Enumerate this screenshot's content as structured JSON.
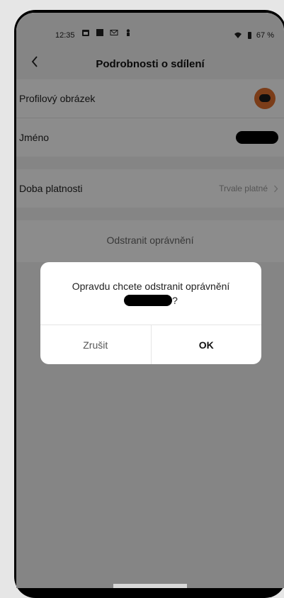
{
  "status_bar": {
    "time": "12:35",
    "battery": "67 %",
    "icons": [
      "calendar-icon",
      "square-icon",
      "mail-icon",
      "person-icon",
      "wifi-icon",
      "battery-icon"
    ]
  },
  "header": {
    "back_icon": "chevron-left-icon",
    "title": "Podrobnosti o sdílení"
  },
  "details": {
    "profile_picture_label": "Profilový obrázek",
    "name_label": "Jméno",
    "validity_label": "Doba platnosti",
    "validity_value": "Trvale platné",
    "remove_label": "Odstranit oprávnění"
  },
  "dialog": {
    "message": "Opravdu chcete odstranit oprávnění",
    "suffix": "?",
    "cancel_label": "Zrušit",
    "ok_label": "OK"
  },
  "colors": {
    "overlay": "#000000",
    "avatar": "#e0702f"
  }
}
